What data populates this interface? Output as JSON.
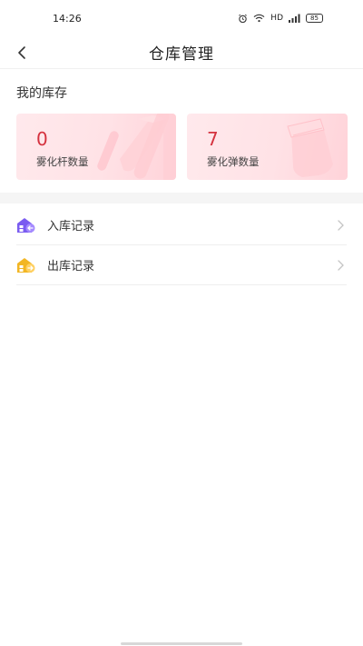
{
  "status_bar": {
    "time": "14:26",
    "network": "HD",
    "battery": "85",
    "icons": [
      "alarm-icon",
      "wifi-icon",
      "signal-icon",
      "battery-icon"
    ]
  },
  "nav": {
    "title": "仓库管理",
    "back_icon": "chevron-left-icon"
  },
  "inventory": {
    "section_title": "我的库存",
    "cards": [
      {
        "count": "0",
        "label": "雾化杆数量",
        "icon": "vape-stick-icon"
      },
      {
        "count": "7",
        "label": "雾化弹数量",
        "icon": "vape-cartridge-icon"
      }
    ]
  },
  "records": [
    {
      "label": "入库记录",
      "icon": "inbound-warehouse-icon",
      "icon_color": "#7a5cf0"
    },
    {
      "label": "出库记录",
      "icon": "outbound-warehouse-icon",
      "icon_color": "#f2b624"
    }
  ],
  "colors": {
    "accent_red": "#d5323f",
    "card_bg": "#ffe2e6"
  }
}
